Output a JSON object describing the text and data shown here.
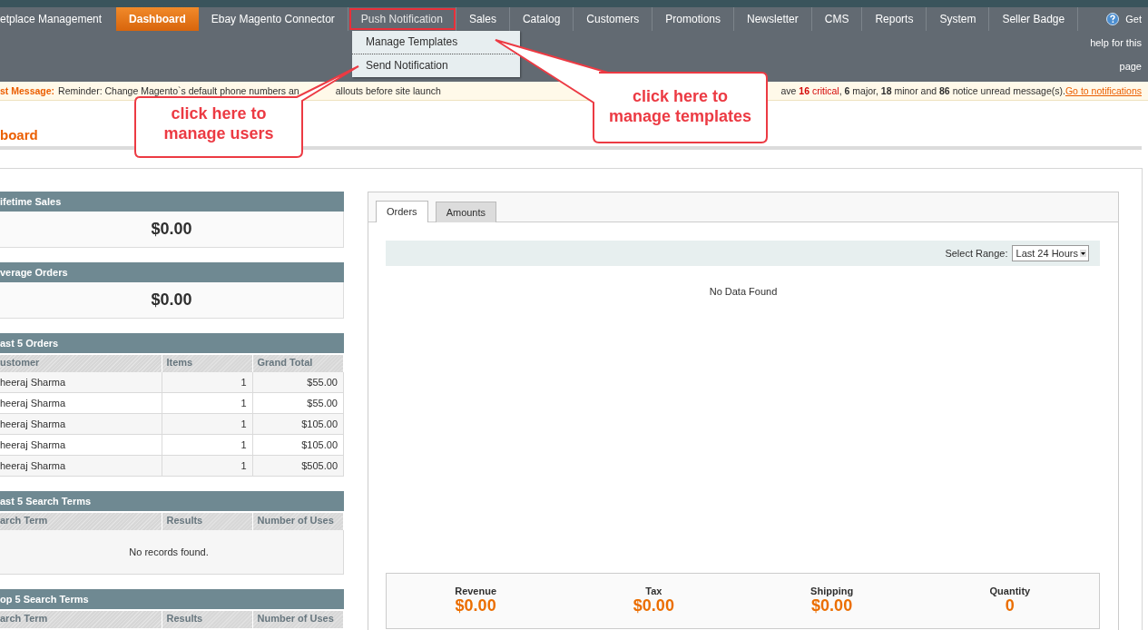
{
  "nav": {
    "items": [
      {
        "label": "etplace Management",
        "selected": false,
        "highlighted": false
      },
      {
        "label": "Dashboard",
        "selected": true,
        "highlighted": false
      },
      {
        "label": "Ebay Magento Connector",
        "selected": false,
        "highlighted": false
      },
      {
        "label": "Push Notification",
        "selected": false,
        "highlighted": true
      },
      {
        "label": "Sales",
        "selected": false,
        "highlighted": false
      },
      {
        "label": "Catalog",
        "selected": false,
        "highlighted": false
      },
      {
        "label": "Customers",
        "selected": false,
        "highlighted": false
      },
      {
        "label": "Promotions",
        "selected": false,
        "highlighted": false
      },
      {
        "label": "Newsletter",
        "selected": false,
        "highlighted": false
      },
      {
        "label": "CMS",
        "selected": false,
        "highlighted": false
      },
      {
        "label": "Reports",
        "selected": false,
        "highlighted": false
      },
      {
        "label": "System",
        "selected": false,
        "highlighted": false
      },
      {
        "label": "Seller Badge",
        "selected": false,
        "highlighted": false
      }
    ],
    "help": "Get help for this page",
    "dropdown": [
      "Manage Templates",
      "Send Notification"
    ]
  },
  "message": {
    "label": "st Message:",
    "text": "Reminder: Change Magento`s default phone numbers an",
    "text_after": "allouts before site launch",
    "summary": [
      {
        "text": "ave ",
        "kind": "plain"
      },
      {
        "text": "16",
        "kind": "critical-bold"
      },
      {
        "text": " critical",
        "kind": "critical"
      },
      {
        "text": ", ",
        "kind": "plain"
      },
      {
        "text": "6",
        "kind": "bold"
      },
      {
        "text": " major, ",
        "kind": "plain"
      },
      {
        "text": "18",
        "kind": "bold"
      },
      {
        "text": " minor and ",
        "kind": "plain"
      },
      {
        "text": "86",
        "kind": "bold"
      },
      {
        "text": " notice unread message(s). ",
        "kind": "plain"
      }
    ],
    "link": "Go to notifications"
  },
  "page_title": "board",
  "left_panels": [
    {
      "kind": "value",
      "title": "ifetime Sales",
      "value": "$0.00"
    },
    {
      "kind": "value",
      "title": "verage Orders",
      "value": "$0.00"
    },
    {
      "kind": "table",
      "title": "ast 5 Orders",
      "columns": [
        "ustomer",
        "Items",
        "Grand Total"
      ],
      "rows": [
        [
          "heeraj Sharma",
          "1",
          "$55.00"
        ],
        [
          "heeraj Sharma",
          "1",
          "$55.00"
        ],
        [
          "heeraj Sharma",
          "1",
          "$105.00"
        ],
        [
          "heeraj Sharma",
          "1",
          "$105.00"
        ],
        [
          "heeraj Sharma",
          "1",
          "$505.00"
        ]
      ]
    },
    {
      "kind": "table",
      "title": "ast 5 Search Terms",
      "columns": [
        "arch Term",
        "Results",
        "Number of Uses"
      ],
      "empty": "No records found."
    },
    {
      "kind": "table",
      "title": "op 5 Search Terms",
      "columns": [
        "arch Term",
        "Results",
        "Number of Uses"
      ]
    }
  ],
  "chart_panel": {
    "tabs": [
      {
        "label": "Orders",
        "selected": true
      },
      {
        "label": "Amounts",
        "selected": false
      }
    ],
    "range_label": "Select Range:",
    "range_value": "Last 24 Hours",
    "empty_text": "No Data Found",
    "totals": [
      {
        "label": "Revenue",
        "value": "$0.00"
      },
      {
        "label": "Tax",
        "value": "$0.00"
      },
      {
        "label": "Shipping",
        "value": "$0.00"
      },
      {
        "label": "Quantity",
        "value": "0"
      }
    ]
  },
  "callouts": [
    {
      "text": "click here to\nmanage users"
    },
    {
      "text": "click here to\nmanage templates"
    }
  ]
}
